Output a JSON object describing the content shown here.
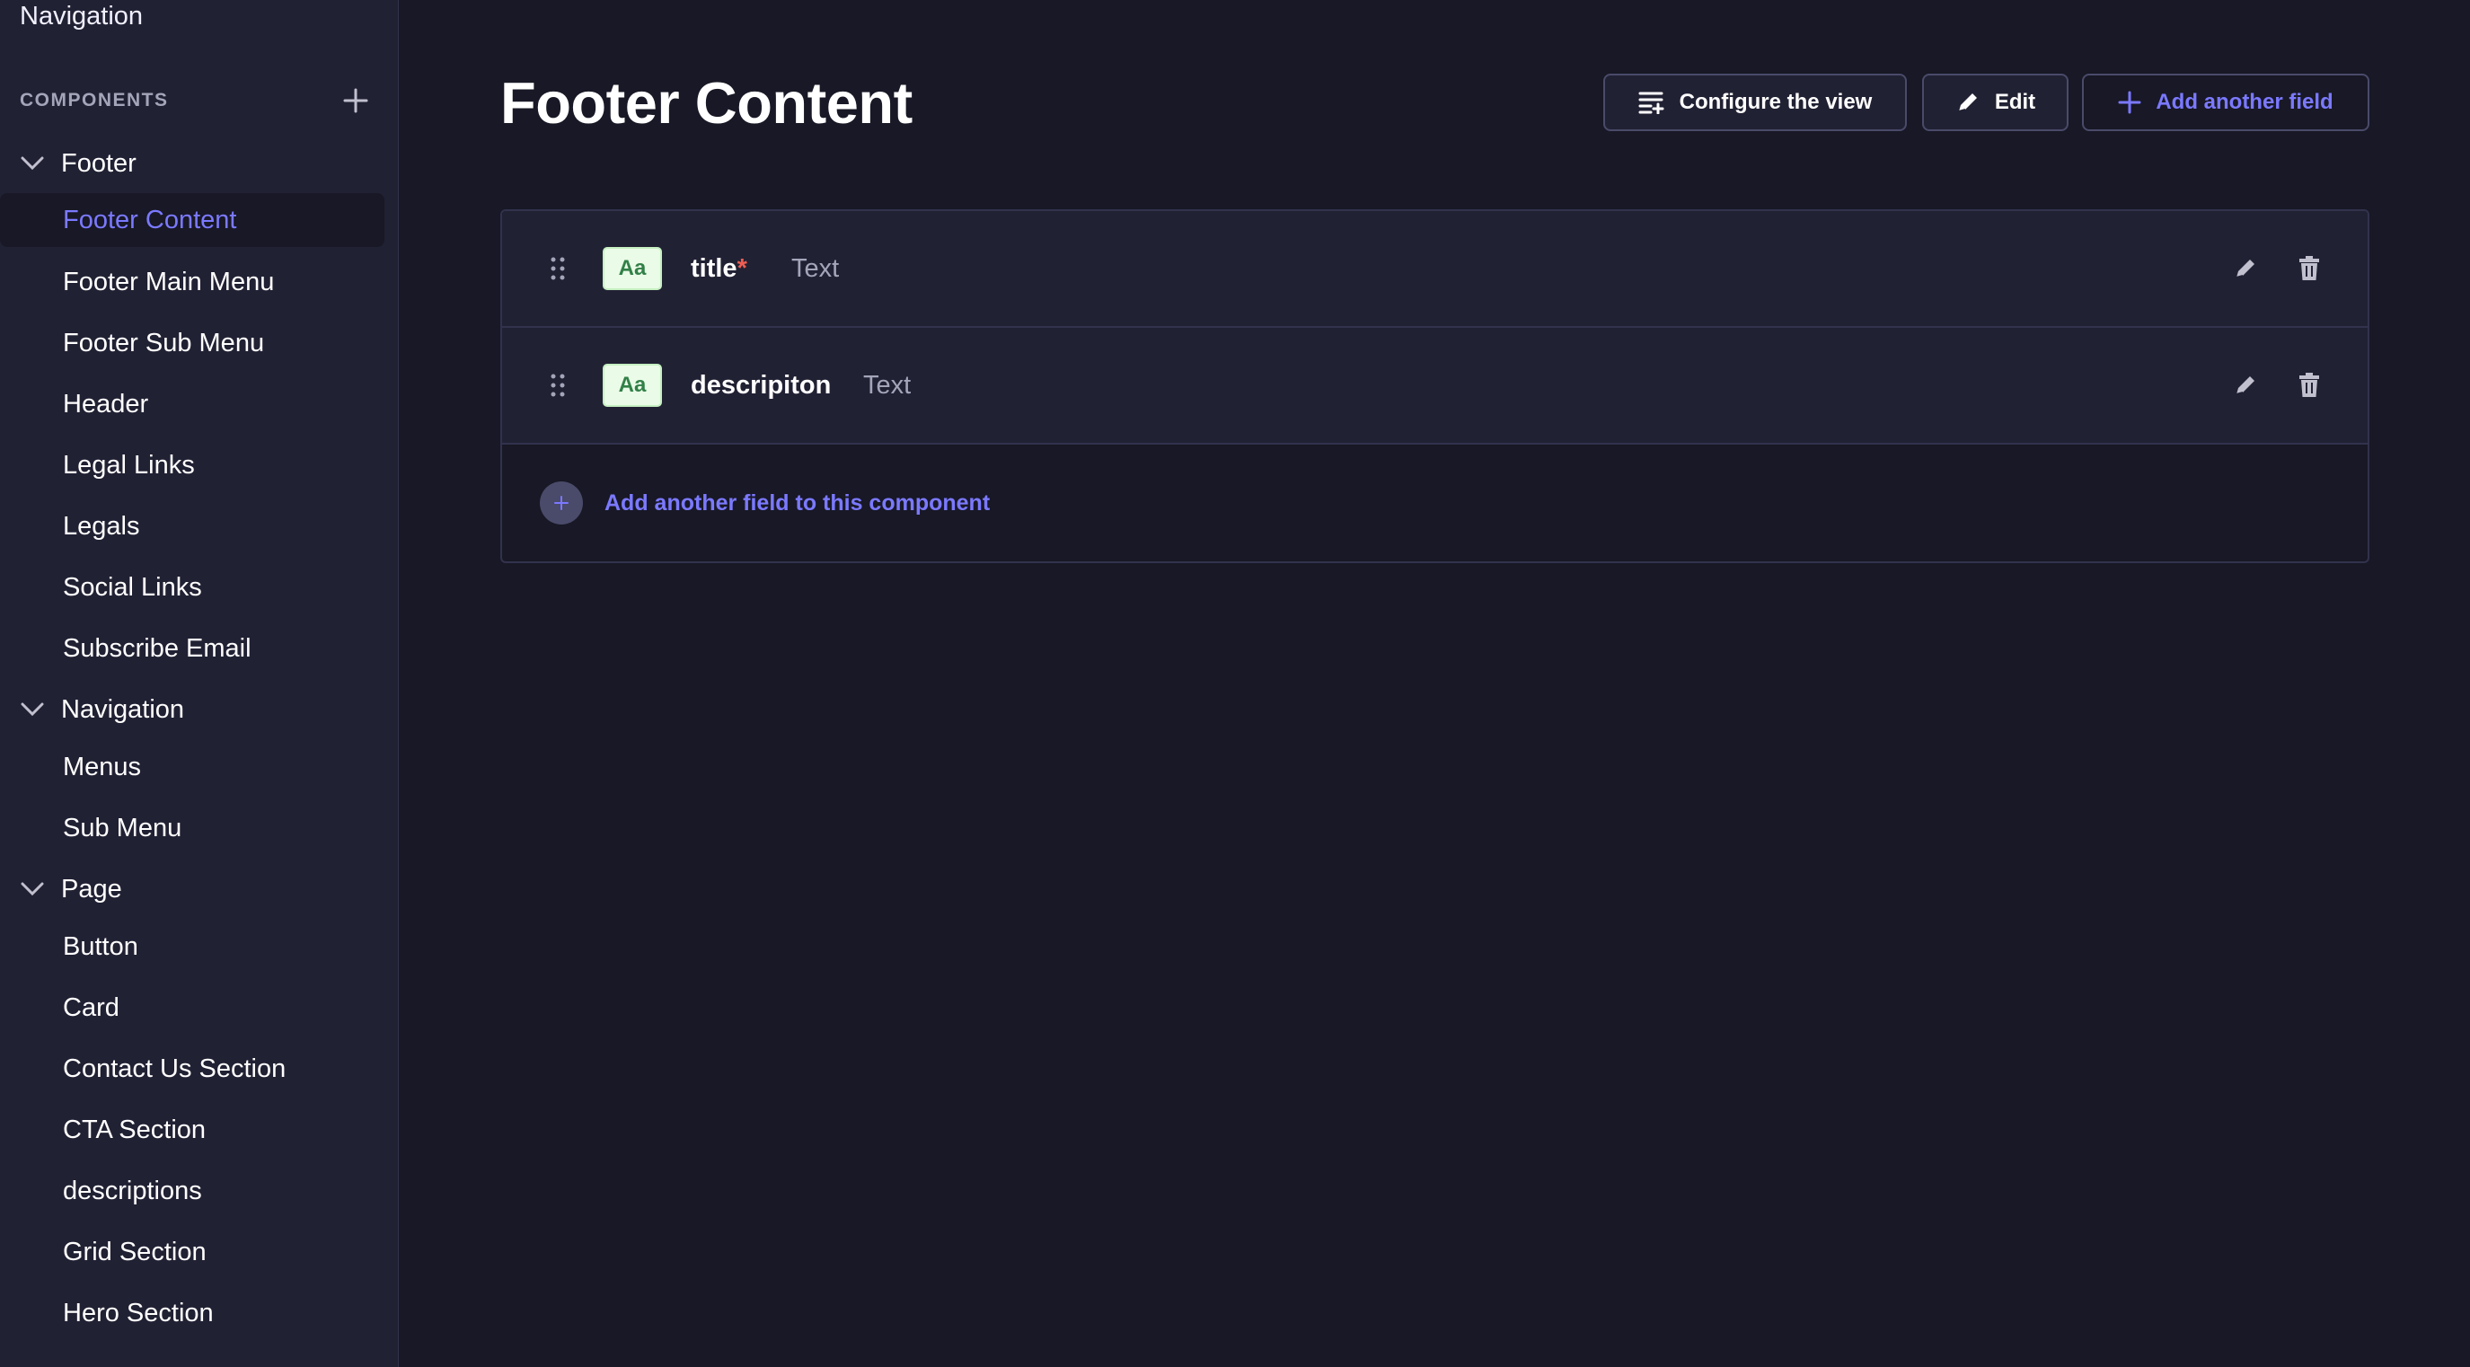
{
  "sidebar": {
    "top_label": "Navigation",
    "section_label": "COMPONENTS",
    "groups": [
      {
        "label": "Footer",
        "items": [
          "Footer Content",
          "Footer Main Menu",
          "Footer Sub Menu",
          "Header",
          "Legal Links",
          "Legals",
          "Social Links",
          "Subscribe Email"
        ]
      },
      {
        "label": "Navigation",
        "items": [
          "Menus",
          "Sub Menu"
        ]
      },
      {
        "label": "Page",
        "items": [
          "Button",
          "Card",
          "Contact Us Section",
          "CTA Section",
          "descriptions",
          "Grid Section",
          "Hero Section"
        ]
      }
    ],
    "active_item": "Footer Content"
  },
  "header": {
    "title": "Footer Content",
    "configure_label": "Configure the view",
    "edit_label": "Edit",
    "add_field_label": "Add another field"
  },
  "fields": [
    {
      "name": "title",
      "required": true,
      "required_mark": "*",
      "type": "Text",
      "badge": "Aa"
    },
    {
      "name": "descripiton",
      "required": false,
      "required_mark": "",
      "type": "Text",
      "badge": "Aa"
    }
  ],
  "add_component_field_label": "Add another field to this component",
  "colors": {
    "background": "#181826",
    "sidebar": "#212134",
    "accent": "#7b79ff",
    "required": "#ee5e52",
    "badge_bg": "#eafbe7",
    "badge_text": "#328048"
  },
  "icons": {
    "plus": "plus-icon",
    "chevron": "chevron-down-icon",
    "configure": "list-settings-icon",
    "edit": "pencil-icon",
    "drag": "drag-handle-icon",
    "delete": "trash-icon"
  }
}
